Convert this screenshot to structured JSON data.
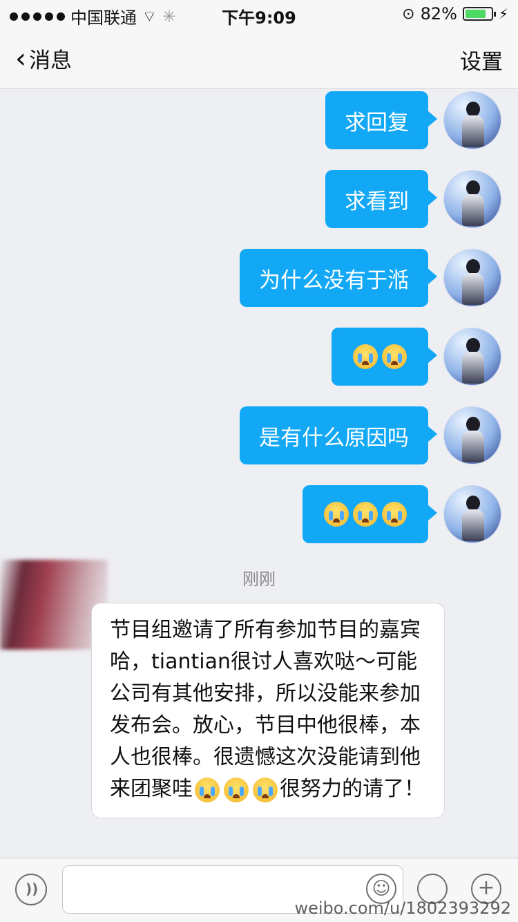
{
  "status_bar": {
    "carrier": "中国联通",
    "time": "下午9:09",
    "battery": "82%",
    "battery_level": 0.82
  },
  "nav": {
    "back_label": "消息",
    "settings_label": "设置"
  },
  "messages_out": [
    {
      "text": "求回复"
    },
    {
      "text": "求看到"
    },
    {
      "text": "为什么没有于湉"
    },
    {
      "emoji_count": 2,
      "emoji": "crying-face-icon"
    },
    {
      "text": "是有什么原因吗"
    },
    {
      "emoji_count": 3,
      "emoji": "crying-face-icon"
    }
  ],
  "timestamp": "刚刚",
  "message_in": {
    "text_before": "节目组邀请了所有参加节目的嘉宾哈，tiantian很讨人喜欢哒～可能公司有其他安排，所以没能来参加发布会。放心，节目中他很棒，本人也很棒。很遗憾这次没能请到他来团聚哇",
    "emoji_count": 3,
    "text_after": "很努力的请了！"
  },
  "watermark": "weibo.com/u/1802393292"
}
